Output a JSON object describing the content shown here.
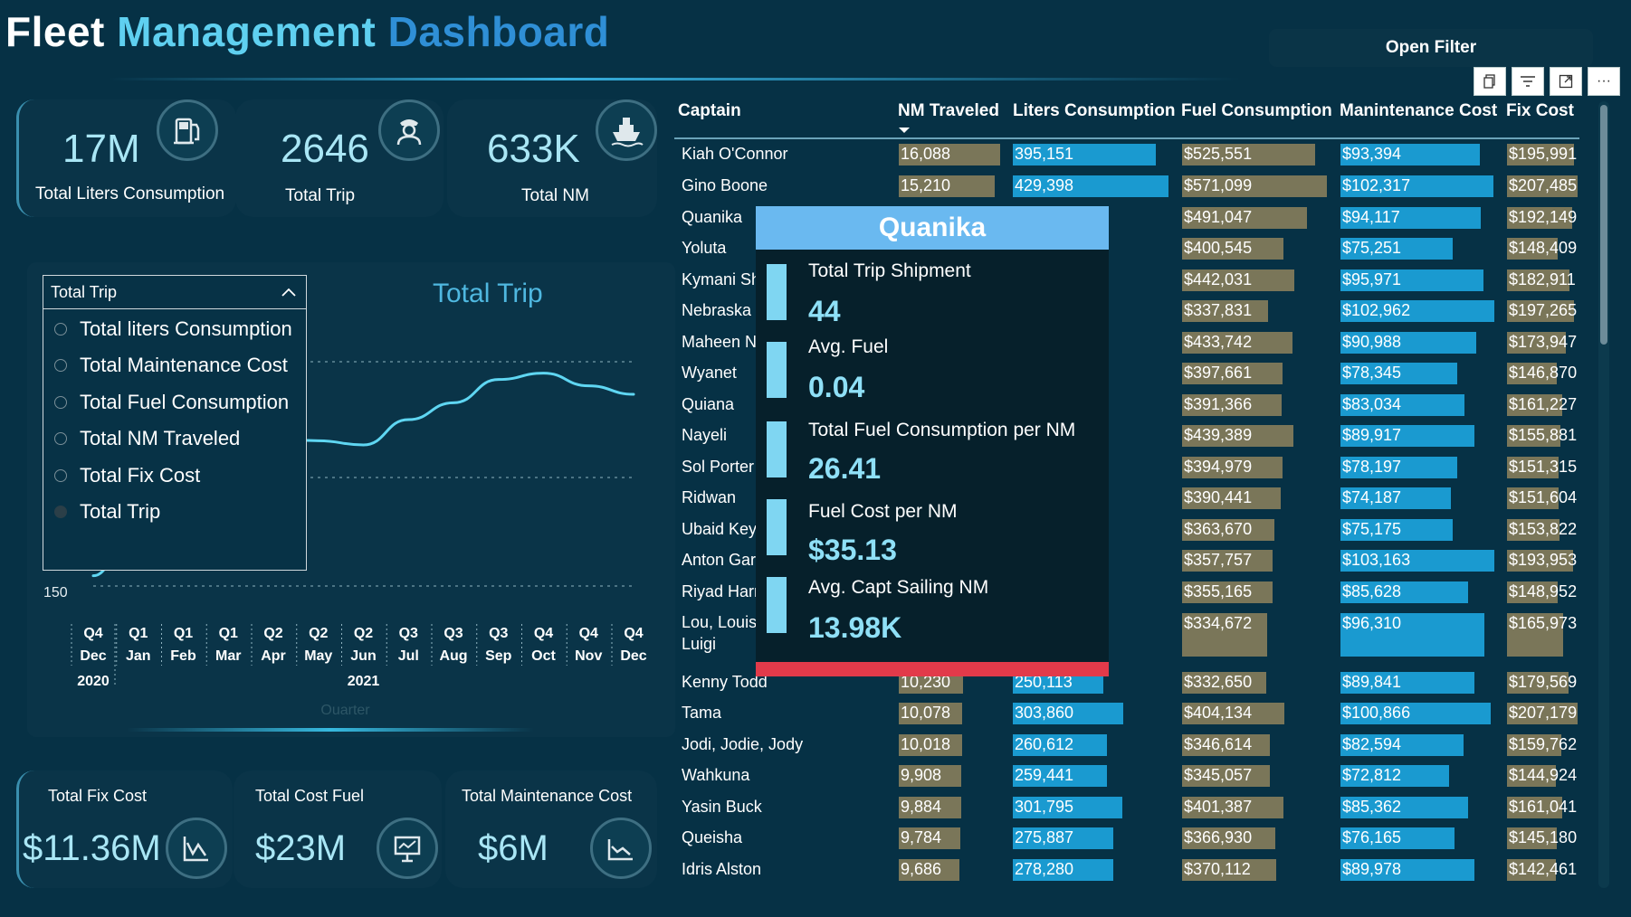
{
  "header": {
    "title_part1": "Fleet",
    "title_part2": "Management",
    "title_part3": "Dashboard",
    "open_filter": "Open Filter",
    "visual_icons": [
      "copy-icon",
      "filter-icon",
      "focus-mode-icon",
      "more-options-icon"
    ]
  },
  "kpis_top": [
    {
      "value": "17M",
      "label": "Total Liters Consumption",
      "icon": "fuel-pump-icon"
    },
    {
      "value": "2646",
      "label": "Total Trip",
      "icon": "captain-icon"
    },
    {
      "value": "633K",
      "label": "Total NM",
      "icon": "ship-icon"
    }
  ],
  "kpis_bottom": [
    {
      "value": "$11.36M",
      "label": "Total Fix Cost",
      "icon": "chart-line-icon"
    },
    {
      "value": "$23M",
      "label": "Total Cost Fuel",
      "icon": "presentation-board-icon"
    },
    {
      "value": "$6M",
      "label": "Total Maintenance Cost",
      "icon": "trend-chart-icon"
    }
  ],
  "measure_selector": {
    "selected": "Total Trip",
    "options": [
      "Total liters Consumption",
      "Total Maintenance Cost",
      "Total Fuel Consumption",
      "Total NM Traveled",
      "Total Fix Cost",
      "Total Trip"
    ]
  },
  "chart_data": {
    "type": "line",
    "title": "Total Trip",
    "xlabel": "Quarter",
    "x": [
      "Q4 Dec 2020",
      "Q1 Jan 2021",
      "Q1 Feb 2021",
      "Q1 Mar 2021",
      "Q2 Apr 2021",
      "Q2 May 2021",
      "Q2 Jun 2021",
      "Q3 Jul 2021",
      "Q3 Aug 2021",
      "Q3 Sep 2021",
      "Q4 Oct 2021",
      "Q4 Nov 2021",
      "Q4 Dec 2021"
    ],
    "quarter_labels": [
      "Q4",
      "Q1",
      "Q1",
      "Q1",
      "Q2",
      "Q2",
      "Q2",
      "Q3",
      "Q3",
      "Q3",
      "Q4",
      "Q4",
      "Q4"
    ],
    "month_labels": [
      "Dec",
      "Jan",
      "Feb",
      "Mar",
      "Apr",
      "May",
      "Jun",
      "Jul",
      "Aug",
      "Sep",
      "Oct",
      "Nov",
      "Dec"
    ],
    "year_labels": [
      "2020",
      "2021"
    ],
    "y_tick_visible": "150",
    "series": [
      {
        "values": [
          150,
          180,
          175,
          205,
          215,
          214,
          212,
          224,
          232,
          243,
          246,
          240,
          236
        ]
      }
    ],
    "ylim": [
      140,
      260
    ],
    "grid": true,
    "line_color": "#5fd6f2"
  },
  "table": {
    "columns": [
      "Captain",
      "NM Traveled",
      "Liters Consumption",
      "Fuel Consumption",
      "Manintenance Cost",
      "Fix Cost"
    ],
    "rows": [
      [
        "Kiah O'Connor",
        "16,088",
        "395,151",
        "$525,551",
        "$93,394",
        "$195,991"
      ],
      [
        "Gino Boone",
        "15,210",
        "429,398",
        "$571,099",
        "$102,317",
        "$207,485"
      ],
      [
        "Quanika",
        "",
        "",
        "$491,047",
        "$94,117",
        "$192,149"
      ],
      [
        "Yoluta",
        "",
        "",
        "$400,545",
        "$75,251",
        "$148,409"
      ],
      [
        "Kymani Sh",
        "",
        "",
        "$442,031",
        "$95,971",
        "$182,911"
      ],
      [
        "Nebraska",
        "",
        "",
        "$337,831",
        "$102,962",
        "$197,265"
      ],
      [
        "Maheen N",
        "",
        "",
        "$433,742",
        "$90,988",
        "$173,947"
      ],
      [
        "Wyanet",
        "",
        "",
        "$397,661",
        "$78,345",
        "$146,870"
      ],
      [
        "Quiana",
        "",
        "",
        "$391,366",
        "$83,034",
        "$161,227"
      ],
      [
        "Nayeli",
        "",
        "",
        "$439,389",
        "$89,917",
        "$155,881"
      ],
      [
        "Sol Porter",
        "",
        "",
        "$394,979",
        "$78,197",
        "$151,315"
      ],
      [
        "Ridwan",
        "",
        "",
        "$390,441",
        "$74,187",
        "$151,604"
      ],
      [
        "Ubaid Key",
        "",
        "",
        "$363,670",
        "$75,175",
        "$153,822"
      ],
      [
        "Anton Gar",
        "",
        "",
        "$357,757",
        "$103,163",
        "$193,953"
      ],
      [
        "Riyad Harr",
        "",
        "",
        "$355,165",
        "$85,628",
        "$148,952"
      ],
      [
        "Lou, Louis, Luigi",
        "",
        "",
        "$334,672",
        "$96,310",
        "$165,973"
      ],
      [
        "Kenny Todd",
        "10,230",
        "250,113",
        "$332,650",
        "$89,841",
        "$179,569"
      ],
      [
        "Tama",
        "10,078",
        "303,860",
        "$404,134",
        "$100,866",
        "$207,179"
      ],
      [
        "Jodi, Jodie, Jody",
        "10,018",
        "260,612",
        "$346,614",
        "$82,594",
        "$159,762"
      ],
      [
        "Wahkuna",
        "9,908",
        "259,441",
        "$345,057",
        "$72,812",
        "$144,924"
      ],
      [
        "Yasin Buck",
        "9,884",
        "301,795",
        "$401,387",
        "$85,362",
        "$161,041"
      ],
      [
        "Queisha",
        "9,784",
        "275,887",
        "$366,930",
        "$76,165",
        "$145,180"
      ],
      [
        "Idris Alston",
        "9,686",
        "278,280",
        "$370,112",
        "$89,978",
        "$142,461"
      ]
    ],
    "bar_colors": {
      "nm": "#7a7659",
      "liters": "#1a9ad0",
      "fuel": "#7a7659",
      "maint": "#1a9ad0",
      "fix": "#7a7659"
    }
  },
  "tooltip": {
    "title": "Quanika",
    "items": [
      {
        "label": "Total Trip Shipment",
        "value": "44"
      },
      {
        "label": "Avg. Fuel",
        "value": "0.04"
      },
      {
        "label": "Total Fuel Consumption per NM",
        "value": "26.41"
      },
      {
        "label": "Fuel Cost per NM",
        "value": "$35.13"
      },
      {
        "label": "Avg. Capt Sailing NM",
        "value": "13.98K"
      }
    ]
  }
}
